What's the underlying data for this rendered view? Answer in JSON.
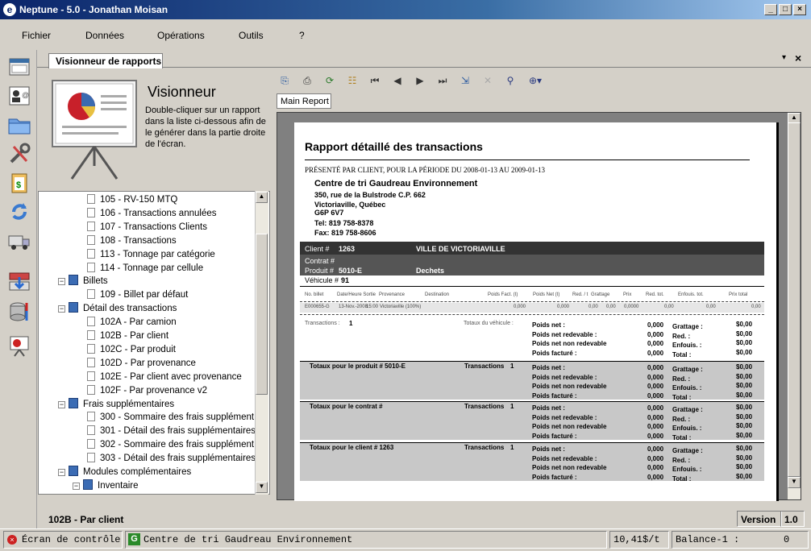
{
  "window": {
    "title": "Neptune - 5.0 - Jonathan Moisan"
  },
  "menu": [
    "Fichier",
    "Données",
    "Opérations",
    "Outils",
    "?"
  ],
  "tab": {
    "label": "Visionneur de rapports"
  },
  "viewer": {
    "title": "Visionneur",
    "description": "Double-cliquer sur un rapport dans la liste ci-dessous afin de le générer dans la partie droite de l'écran."
  },
  "tree": {
    "items": [
      {
        "label": "105 - RV-150 MTQ",
        "level": 2
      },
      {
        "label": "106 - Transactions annulées",
        "level": 2
      },
      {
        "label": "107 - Transactions Clients",
        "level": 2
      },
      {
        "label": "108 - Transactions",
        "level": 2
      },
      {
        "label": "113 - Tonnage par catégorie",
        "level": 2
      },
      {
        "label": "114 - Tonnage par cellule",
        "level": 2
      },
      {
        "label": "Billets",
        "level": 1
      },
      {
        "label": "109 - Billet par défaut",
        "level": 2
      },
      {
        "label": "Détail des transactions",
        "level": 1
      },
      {
        "label": "102A - Par camion",
        "level": 2
      },
      {
        "label": "102B - Par client",
        "level": 2
      },
      {
        "label": "102C - Par produit",
        "level": 2
      },
      {
        "label": "102D - Par provenance",
        "level": 2
      },
      {
        "label": "102E - Par client avec provenance",
        "level": 2
      },
      {
        "label": "102F - Par provenance v2",
        "level": 2
      },
      {
        "label": "Frais supplémentaires",
        "level": 1
      },
      {
        "label": "300 - Sommaire des frais supplément",
        "level": 2
      },
      {
        "label": "301 - Détail des frais supplémentaires",
        "level": 2
      },
      {
        "label": "302 - Sommaire des frais supplément",
        "level": 2
      },
      {
        "label": "303 - Détail des frais supplémentaires",
        "level": 2
      },
      {
        "label": "Modules complémentaires",
        "level": 1
      },
      {
        "label": "Inventaire",
        "level": 2
      }
    ]
  },
  "report_tab": {
    "label": "Main Report"
  },
  "report": {
    "title": "Rapport détaillé des transactions",
    "subtitle": "PRÉSENTÉ PAR CLIENT, POUR LA PÉRIODE DU 2008-01-13 AU 2009-01-13",
    "company": "Centre de tri Gaudreau Environnement",
    "address1": "350, rue de la Bulstrode C.P. 662",
    "address2": "Victoriaville, Québec",
    "postal": "G6P 6V7",
    "tel": "Tel: 819 758-8378",
    "fax": "Fax: 819 758-8606",
    "client_label": "Client #",
    "client_num": "1263",
    "client_name": "VILLE DE VICTORIAVILLE",
    "contrat_label": "Contrat #",
    "produit_label": "Produit #",
    "produit_num": "5010-E",
    "produit_name": "Dechets",
    "vehicule_label": "Véhicule #",
    "vehicule_num": "91",
    "columns": [
      "No. billet",
      "Date/Heure Sortie",
      "Provenance",
      "Destination",
      "Poids Fact. (t)",
      "Poids Net (t)",
      "Red. / t",
      "Grattage",
      "Prix",
      "Red. tot.",
      "Enfouis. tot.",
      "Prix total"
    ],
    "row": {
      "billet": "E000655-G",
      "date": "13-Nov.-2008",
      "heure": "15:00",
      "provenance": "Victoriaville (100%)",
      "vals": [
        "0,000",
        "0,000",
        "0,00",
        "0,00",
        "0,0000",
        "0,00",
        "0,00",
        "0,00"
      ]
    },
    "transactions_label": "Transactions :",
    "transactions_count": "1",
    "totaux_vehicule": "Totaux du véhicule :",
    "sections": [
      {
        "label": "Totaux pour le produit # 5010-E"
      },
      {
        "label": "Totaux pour le contrat #"
      },
      {
        "label": "Totaux pour le client # 1263"
      }
    ],
    "tx_label": "Transactions",
    "tx_count": "1",
    "poids_labels": [
      "Poids net :",
      "Poids net redevable :",
      "Poids net non redevable",
      "Poids facturé :"
    ],
    "poids_values": [
      "0,000",
      "0,000",
      "0,000",
      "0,000"
    ],
    "cost_labels": [
      "Grattage :",
      "Red. :",
      "Enfouis. :",
      "Total :"
    ],
    "cost_values": [
      "$0,00",
      "$0,00",
      "$0,00",
      "$0,00"
    ]
  },
  "selected": {
    "label": "102B - Par client"
  },
  "version": {
    "label": "Version",
    "value": "1.0"
  },
  "status": {
    "control": "Écran de contrôle",
    "company": "Centre de tri Gaudreau Environnement",
    "rate": "10,41$/t",
    "balance_label": "Balance-1 :",
    "balance_value": "0"
  },
  "colors": {
    "titlebar": "#0a246a",
    "report_band_dark": "#333333",
    "report_band_gray": "#c0c0c0"
  }
}
